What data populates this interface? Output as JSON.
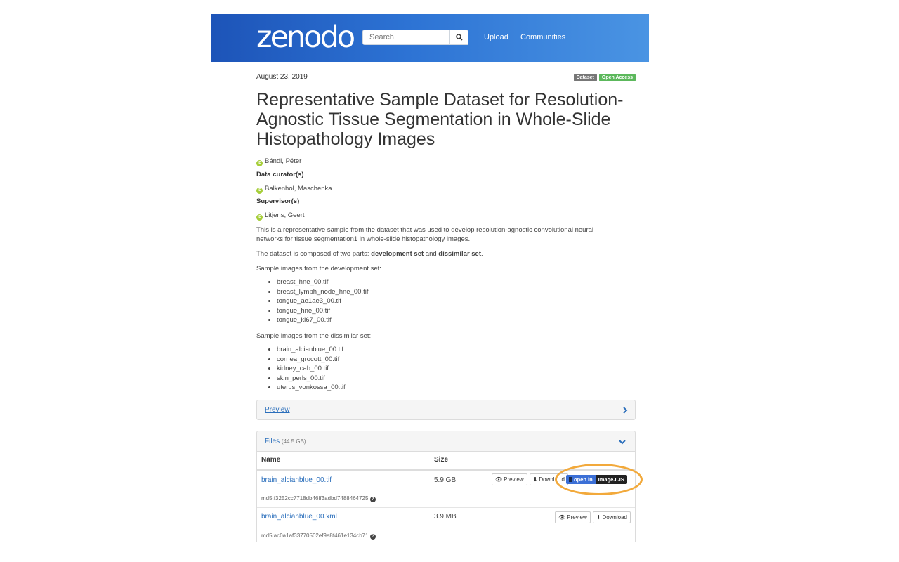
{
  "header": {
    "logo": "zenodo",
    "search_placeholder": "Search",
    "nav": [
      "Upload",
      "Communities"
    ]
  },
  "record": {
    "date": "August 23, 2019",
    "badges": [
      {
        "label": "Dataset",
        "color": "#777777"
      },
      {
        "label": "Open Access",
        "color": "#5cb85c"
      }
    ],
    "title": "Representative Sample Dataset for Resolution-Agnostic Tissue Segmentation in Whole-Slide Histopathology Images",
    "creator": "Bándi, Péter",
    "curator_label": "Data curator(s)",
    "curator": "Balkenhol, Maschenka",
    "supervisor_label": "Supervisor(s)",
    "supervisor": "Litjens, Geert",
    "description": "This is a representative sample from the dataset that was used to develop resolution-agnostic convolutional neural networks for tissue segmentation1 in whole-slide histopathology images.",
    "composition_prefix": "The dataset is composed of two parts: ",
    "composition_part1": "development set",
    "composition_and": " and ",
    "composition_part2": "dissimilar set",
    "composition_suffix": ".",
    "dev_heading": "Sample images from the development set:",
    "dev_files": [
      "breast_hne_00.tif",
      "breast_lymph_node_hne_00.tif",
      "tongue_ae1ae3_00.tif",
      "tongue_hne_00.tif",
      "tongue_ki67_00.tif"
    ],
    "dis_heading": "Sample images from the dissimilar set:",
    "dis_files": [
      "brain_alcianblue_00.tif",
      "cornea_grocott_00.tif",
      "kidney_cab_00.tif",
      "skin_perls_00.tif",
      "uterus_vonkossa_00.tif"
    ]
  },
  "preview_panel": {
    "label": "Preview"
  },
  "files_panel": {
    "label": "Files",
    "total_size": "(44.5 GB)",
    "columns": [
      "Name",
      "Size"
    ],
    "rows": [
      {
        "name": "brain_alcianblue_00.tif",
        "size": "5.9 GB",
        "md5": "md5:f3252cc7718db46ff3adbd7488464725"
      },
      {
        "name": "brain_alcianblue_00.xml",
        "size": "3.9 MB",
        "md5": "md5:ac0a1af33770502ef9a8f461e134cb71"
      }
    ],
    "preview_btn": "Preview",
    "download_btn": "Download",
    "download_btn_partial": "Downl",
    "download_btn_tail": "d",
    "imagej_open": "open in",
    "imagej_name": "ImageJ.JS"
  },
  "highlight_color": "#f2a93b"
}
